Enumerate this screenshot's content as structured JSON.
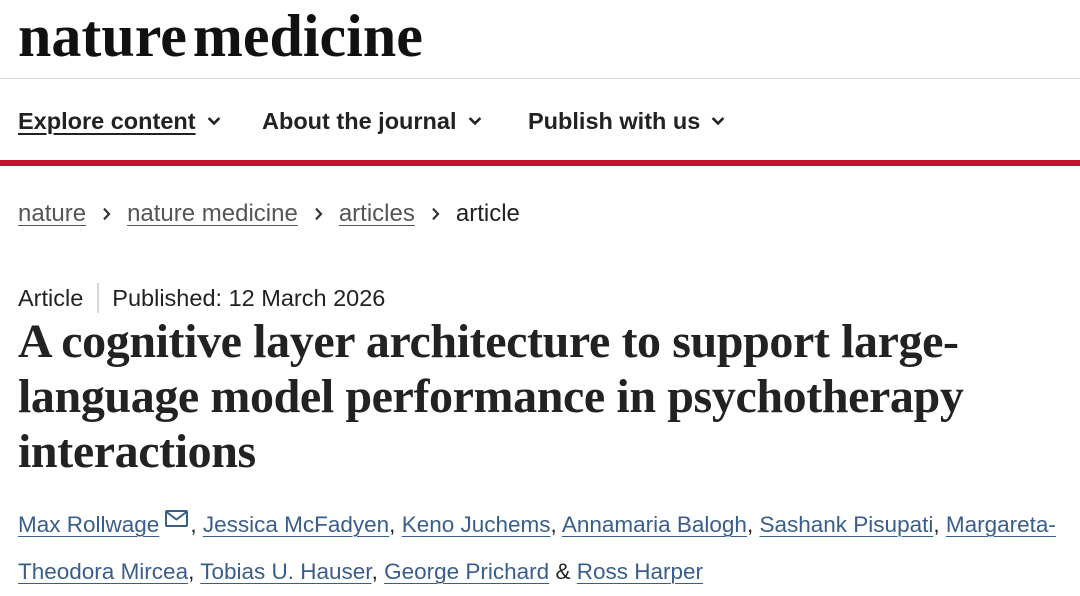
{
  "logo": {
    "text": "nature medicine"
  },
  "nav": {
    "items": [
      {
        "label": "Explore content",
        "icon": "chevron-down-icon",
        "current": true
      },
      {
        "label": "About the journal",
        "icon": "chevron-down-icon"
      },
      {
        "label": "Publish with us",
        "icon": "chevron-down-icon"
      }
    ]
  },
  "breadcrumb": {
    "separator_icon": "chevron-right-icon",
    "items": [
      {
        "label": "nature"
      },
      {
        "label": "nature medicine"
      },
      {
        "label": "articles"
      },
      {
        "label": "article",
        "current": true
      }
    ]
  },
  "article": {
    "type": "Article",
    "published_label": "Published:",
    "published_date": "12 March 2026",
    "title": "A cognitive layer architecture to support large-language model performance in psychotherapy interactions",
    "authors": [
      {
        "name": "Max Rollwage",
        "icon": "envelope-icon"
      },
      {
        "name": "Jessica McFadyen"
      },
      {
        "name": "Keno Juchems"
      },
      {
        "name": "Annamaria Balogh"
      },
      {
        "name": "Sashank Pisupati"
      },
      {
        "name": "Margareta-Theodora Mircea"
      },
      {
        "name": "Tobias U. Hauser"
      },
      {
        "name": "George Prichard"
      },
      {
        "name": "Ross Harper"
      }
    ],
    "author_separator": ",",
    "author_last_separator": "&"
  },
  "colors": {
    "accent": "#c8102e",
    "link": "#3a5e8c",
    "breadcrumb_link": "#555555",
    "text": "#222222"
  }
}
